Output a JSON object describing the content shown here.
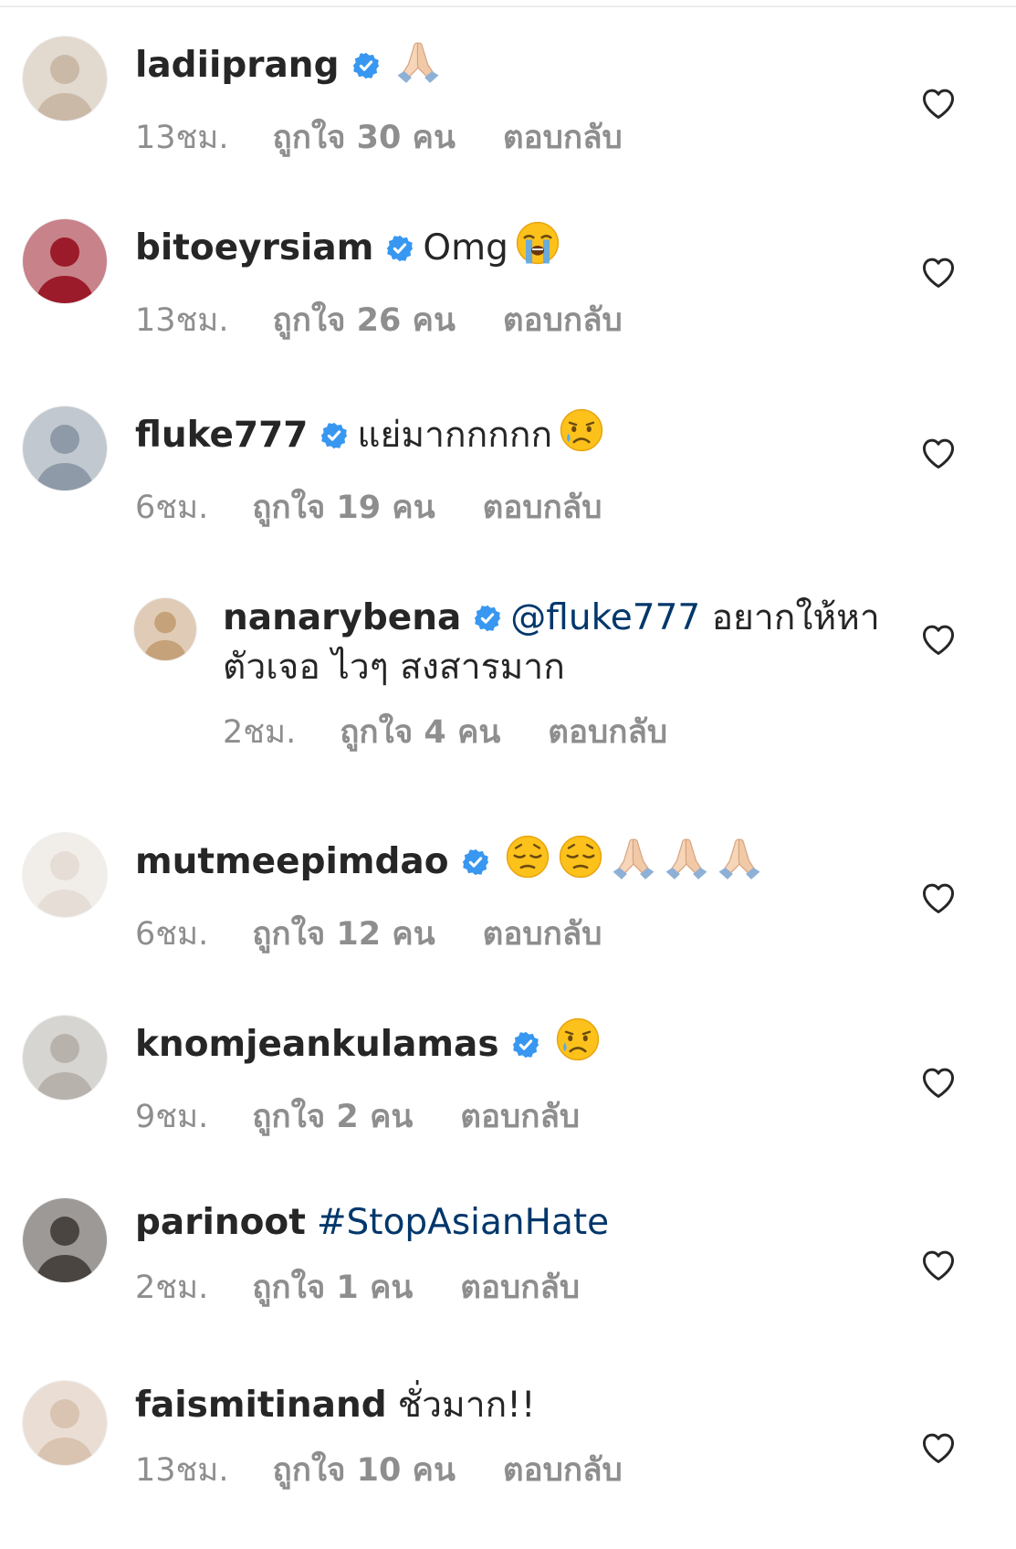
{
  "comments": [
    {
      "user": "ladiiprang",
      "verified": true,
      "text": "",
      "emoji": [
        "pray"
      ],
      "time": "13ชม.",
      "likes": "ถูกใจ 30 คน",
      "reply": "ตอบกลับ",
      "avatar_color": "#cbb9a8"
    },
    {
      "user": "bitoeyrsiam",
      "verified": true,
      "text": "Omg",
      "emoji": [
        "sob"
      ],
      "time": "13ชม.",
      "likes": "ถูกใจ 26 คน",
      "reply": "ตอบกลับ",
      "avatar_color": "#9b1b2a"
    },
    {
      "user": "fluke777",
      "verified": true,
      "text": "แย่มากกกกก",
      "emoji": [
        "cry"
      ],
      "time": "6ชม.",
      "likes": "ถูกใจ 19 คน",
      "reply": "ตอบกลับ",
      "avatar_color": "#8e9aa8"
    },
    {
      "user": "nanarybena",
      "verified": true,
      "mention": "@fluke777",
      "text": "อยากให้หาตัวเจอ ไวๆ สงสารมาก",
      "emoji": [],
      "time": "2ชม.",
      "likes": "ถูกใจ 4 คน",
      "reply": "ตอบกลับ",
      "avatar_color": "#c6a27a",
      "is_reply": true
    },
    {
      "user": "mutmeepimdao",
      "verified": true,
      "text": "",
      "emoji": [
        "pensive",
        "pensive",
        "pray",
        "pray",
        "pray"
      ],
      "time": "6ชม.",
      "likes": "ถูกใจ 12 คน",
      "reply": "ตอบกลับ",
      "avatar_color": "#e6ded6"
    },
    {
      "user": "knomjeankulamas",
      "verified": true,
      "text": "",
      "emoji": [
        "cry"
      ],
      "time": "9ชม.",
      "likes": "ถูกใจ 2 คน",
      "reply": "ตอบกลับ",
      "avatar_color": "#b7b2ac"
    },
    {
      "user": "parinoot",
      "verified": false,
      "hashtag": "#StopAsianHate",
      "text": "",
      "emoji": [],
      "time": "2ชม.",
      "likes": "ถูกใจ 1 คน",
      "reply": "ตอบกลับ",
      "avatar_color": "#4a4541"
    },
    {
      "user": "faismitinand",
      "verified": false,
      "text": "ชั่วมาก!!",
      "emoji": [],
      "time": "13ชม.",
      "likes": "ถูกใจ 10 คน",
      "reply": "ตอบกลับ",
      "avatar_color": "#d9c3b1"
    }
  ],
  "colors": {
    "badge": "#3897f0",
    "meta": "#8e8e8e",
    "mention": "#00376b",
    "heart": "#262626"
  },
  "icons": {
    "badge": "verified-badge-icon",
    "like": "heart-outline-icon",
    "avatar": "avatar"
  }
}
